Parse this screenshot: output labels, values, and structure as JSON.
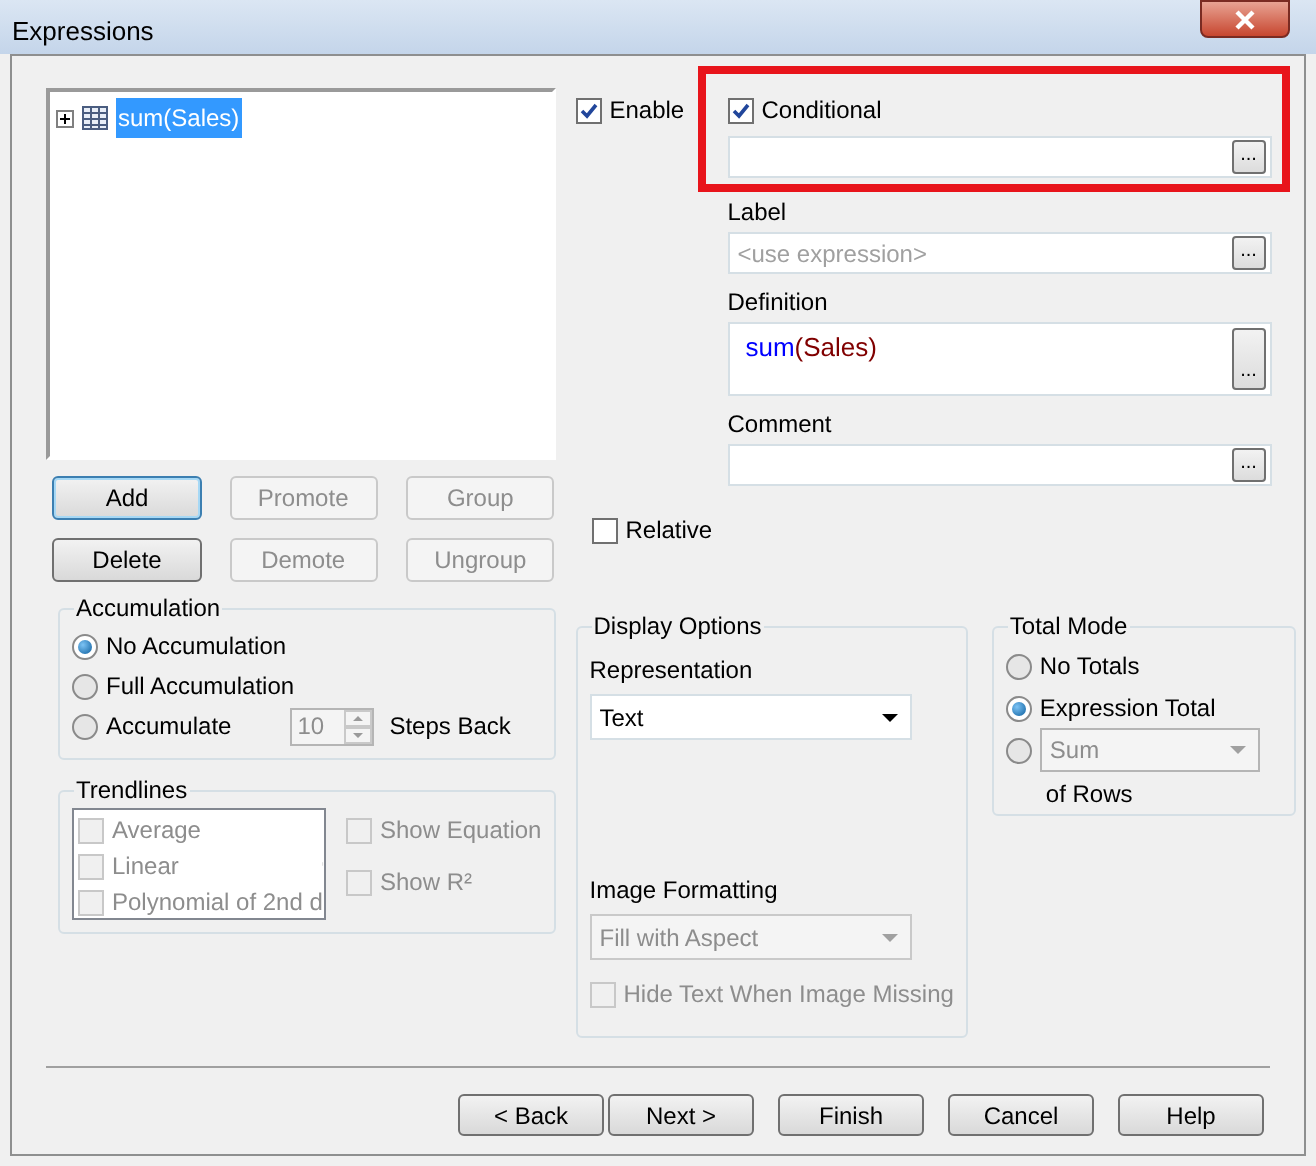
{
  "window": {
    "title": "Expressions"
  },
  "expressions": [
    {
      "label": "sum(Sales)",
      "selected": true,
      "expanded": false
    }
  ],
  "list_buttons": [
    {
      "label": "Add",
      "disabled": false
    },
    {
      "label": "Promote",
      "disabled": true
    },
    {
      "label": "Group",
      "disabled": true
    },
    {
      "label": "Delete",
      "disabled": false
    },
    {
      "label": "Demote",
      "disabled": true
    },
    {
      "label": "Ungroup",
      "disabled": true
    }
  ],
  "enable": {
    "label": "Enable",
    "checked": true
  },
  "conditional": {
    "label": "Conditional",
    "checked": true,
    "button": "..."
  },
  "label_field": {
    "label": "Label",
    "placeholder": "<use expression>",
    "button": "..."
  },
  "definition": {
    "label": "Definition",
    "parts": [
      {
        "text": "sum",
        "color": "#0000ff"
      },
      {
        "text": "(Sales)",
        "color": "#800000"
      }
    ],
    "button": "..."
  },
  "comment": {
    "label": "Comment",
    "button": "..."
  },
  "relative": {
    "label": "Relative",
    "checked": false
  },
  "accumulation": {
    "title": "Accumulation",
    "options": [
      {
        "label": "No Accumulation",
        "selected": true
      },
      {
        "label": "Full Accumulation",
        "selected": false
      },
      {
        "label": "Accumulate",
        "selected": false
      }
    ],
    "steps": {
      "value": "10",
      "label": "Steps Back",
      "disabled": true
    }
  },
  "trendlines": {
    "title": "Trendlines",
    "disabled": true,
    "items": [
      {
        "label": "Average",
        "checked": false
      },
      {
        "label": "Linear",
        "checked": false
      },
      {
        "label": "Polynomial of 2nd d",
        "checked": false
      }
    ],
    "options": [
      {
        "label": "Show Equation",
        "checked": false
      },
      {
        "label": "Show R²",
        "checked": false
      }
    ]
  },
  "display_options": {
    "title": "Display Options",
    "representation": {
      "label": "Representation",
      "value": "Text"
    },
    "image_formatting": {
      "label": "Image Formatting",
      "value": "Fill with Aspect",
      "disabled": true
    },
    "hide_text": {
      "label": "Hide Text When Image Missing",
      "checked": false,
      "disabled": true
    }
  },
  "total_mode": {
    "title": "Total Mode",
    "options": [
      {
        "kind": "plain",
        "label": "No Totals",
        "selected": false
      },
      {
        "kind": "plain",
        "label": "Expression Total",
        "selected": true
      },
      {
        "kind": "dropdown",
        "value": "Sum",
        "suffix": "of Rows",
        "selected": false
      }
    ]
  },
  "footer_buttons": [
    "< Back",
    "Next >",
    "Finish",
    "Cancel",
    "Help"
  ]
}
